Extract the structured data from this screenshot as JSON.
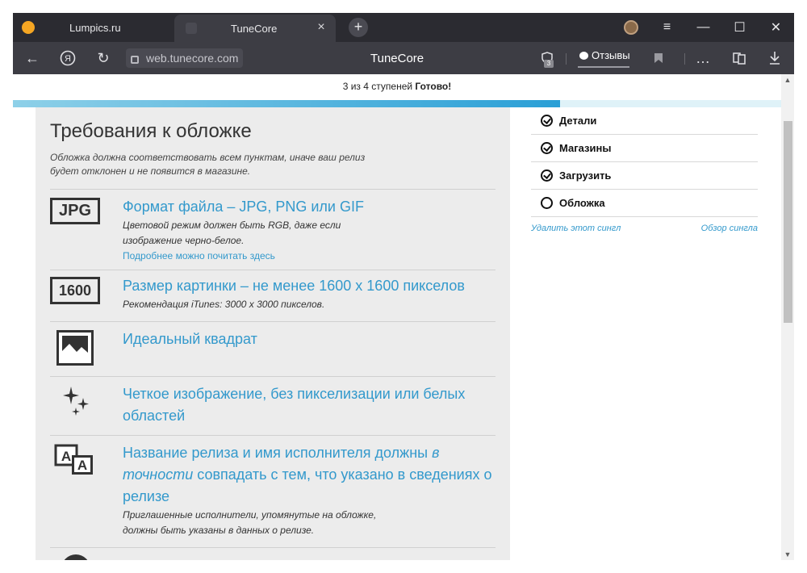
{
  "tabs": [
    {
      "label": "Lumpics.ru"
    },
    {
      "label": "TuneCore"
    }
  ],
  "toolbar": {
    "url": "web.tunecore.com",
    "page_title": "TuneCore",
    "reviews_label": "Отзывы",
    "tab_count": "3"
  },
  "progress": {
    "text_before": "3 из 4 ступеней ",
    "text_strong": "Готово!",
    "fraction": 0.75
  },
  "requirements": {
    "heading": "Требования к обложке",
    "intro": "Обложка должна соответствовать всем пунктам, иначе ваш релиз будет отклонен и не появится в магазине.",
    "items": [
      {
        "icon_text": "JPG",
        "title": "Формат файла – JPG, PNG или GIF",
        "sub1": "Цветовой режим должен быть RGB, даже если",
        "sub2": "изображение черно-белое.",
        "link": "Подробнее можно почитать здесь"
      },
      {
        "icon_text": "1600",
        "title": "Размер картинки – не менее 1600 x 1600 пикселов",
        "sub1": "Рекомендация iTunes: 3000 x 3000 пикселов."
      },
      {
        "title": "Идеальный квадрат"
      },
      {
        "title1": "Четкое изображение, без пикселизации или белых",
        "title2": "областей"
      },
      {
        "icon_text_a": "A",
        "icon_text_b": "A",
        "title_l1a": "Название релиза и имя исполнителя должны ",
        "title_l1b": "в",
        "title_l2a": "точности",
        "title_l2b": " совпадать с тем, что указано в сведениях о",
        "title_l3": "релизе",
        "sub1": "Приглашенные исполнители, упомянутые на обложке,",
        "sub2": "должны быть указаны в данных о релизе."
      }
    ]
  },
  "sidebar": {
    "items": [
      {
        "label": "Детали"
      },
      {
        "label": "Магазины"
      },
      {
        "label": "Загрузить"
      },
      {
        "label": "Обложка"
      }
    ],
    "delete_link": "Удалить этот сингл",
    "review_link": "Обзор сингла"
  },
  "icons": {
    "close": "close-icon",
    "plus": "plus-icon",
    "back": "back-arrow-icon",
    "yandex": "yandex-icon",
    "reload": "reload-icon",
    "lock": "lock-icon",
    "bookmark": "bookmark-icon",
    "download": "download-icon"
  },
  "colors": {
    "accent_link": "#3399cc",
    "browser_dark": "#2b2b31",
    "progress_fill": "#2a9fd6"
  }
}
